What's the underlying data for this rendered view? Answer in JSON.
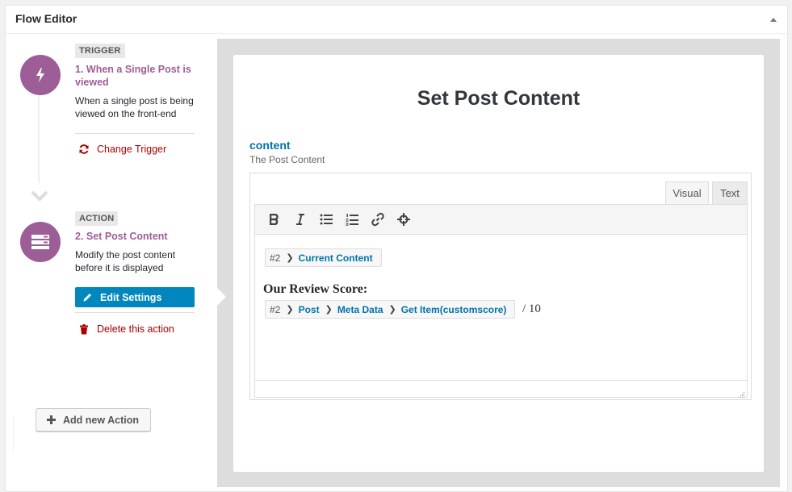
{
  "panel": {
    "title": "Flow Editor"
  },
  "icons": {
    "collapse": "triangle-up-icon",
    "trigger": "lightning-icon",
    "action": "stack-icon",
    "flow_arrow": "chevron-down-icon",
    "change": "refresh-icon",
    "edit": "pencil-icon",
    "delete": "trash-icon",
    "add": "plus-icon"
  },
  "colors": {
    "step_circle": "#9d5d96",
    "link_red": "#aa0000",
    "primary_blue": "#0087be",
    "link_blue": "#0073aa"
  },
  "flow": {
    "trigger": {
      "tag": "TRIGGER",
      "title": "1. When a Single Post is viewed",
      "description": "When a single post is being viewed on the front-end",
      "change_label": "Change Trigger"
    },
    "action": {
      "tag": "ACTION",
      "title": "2. Set Post Content",
      "description": "Modify the post content before it is displayed",
      "edit_label": "Edit Settings",
      "delete_label": "Delete this action"
    },
    "add_action_label": "Add new Action"
  },
  "settings": {
    "title": "Set Post Content",
    "field": {
      "label": "content",
      "description": "The Post Content"
    },
    "editor": {
      "tabs": [
        {
          "label": "Visual",
          "active": true
        },
        {
          "label": "Text",
          "active": false
        }
      ],
      "toolbar": [
        "bold",
        "italic",
        "bullet-list",
        "numbered-list",
        "link",
        "move"
      ],
      "token1": {
        "num": "#2",
        "segments": [
          "Current Content"
        ]
      },
      "review_label": "Our Review Score:",
      "token2": {
        "num": "#2",
        "segments": [
          "Post",
          "Meta Data",
          "Get Item(customscore)"
        ]
      },
      "out_of": "/ 10"
    }
  }
}
